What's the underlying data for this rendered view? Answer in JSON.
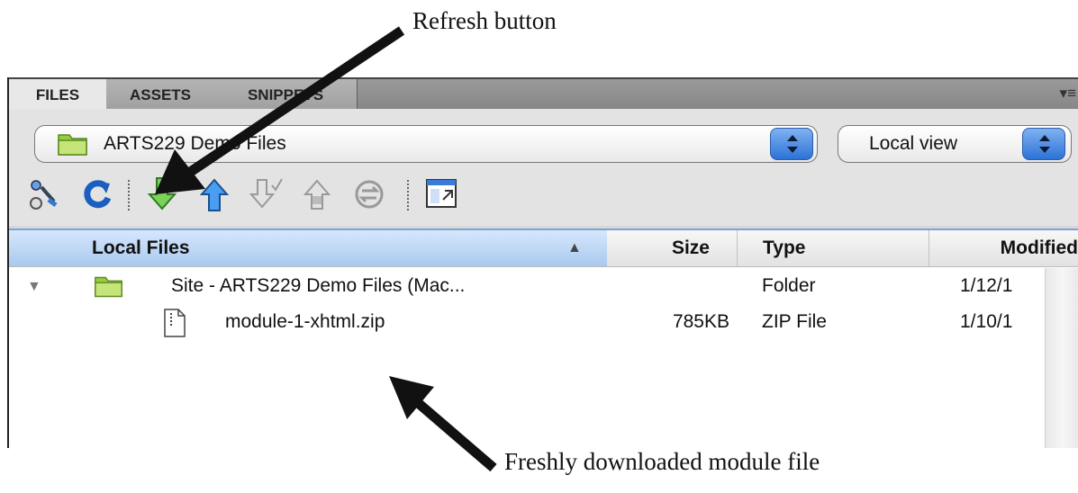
{
  "annotations": {
    "refresh_callout": "Refresh button",
    "module_callout": "Freshly downloaded module file"
  },
  "tabs": [
    {
      "label": "FILES",
      "active": true
    },
    {
      "label": "ASSETS",
      "active": false
    },
    {
      "label": "SNIPPETS",
      "active": false
    }
  ],
  "panel_menu_icon": "options-menu-icon",
  "site_select": {
    "value": "ARTS229 Demo Files",
    "icon": "folder-icon"
  },
  "view_select": {
    "value": "Local view"
  },
  "toolbar_icons": [
    "connect-icon",
    "refresh-icon",
    "get-icon",
    "put-icon",
    "check-out-icon",
    "check-in-icon",
    "synchronize-icon",
    "expand-icon"
  ],
  "table": {
    "columns": {
      "name": "Local Files",
      "size": "Size",
      "type": "Type",
      "modified": "Modified"
    },
    "sort_indicator": "▲",
    "rows": [
      {
        "name": "Site - ARTS229 Demo Files (Mac...",
        "size": "",
        "type": "Folder",
        "modified": "1/12/1"
      },
      {
        "name": "module-1-xhtml.zip",
        "size": "785KB",
        "type": "ZIP File",
        "modified": "1/10/1"
      }
    ]
  },
  "colors": {
    "header_selected": "#a9c9ef",
    "stepper": "#2c72d6",
    "panel": "#e3e3e3"
  }
}
